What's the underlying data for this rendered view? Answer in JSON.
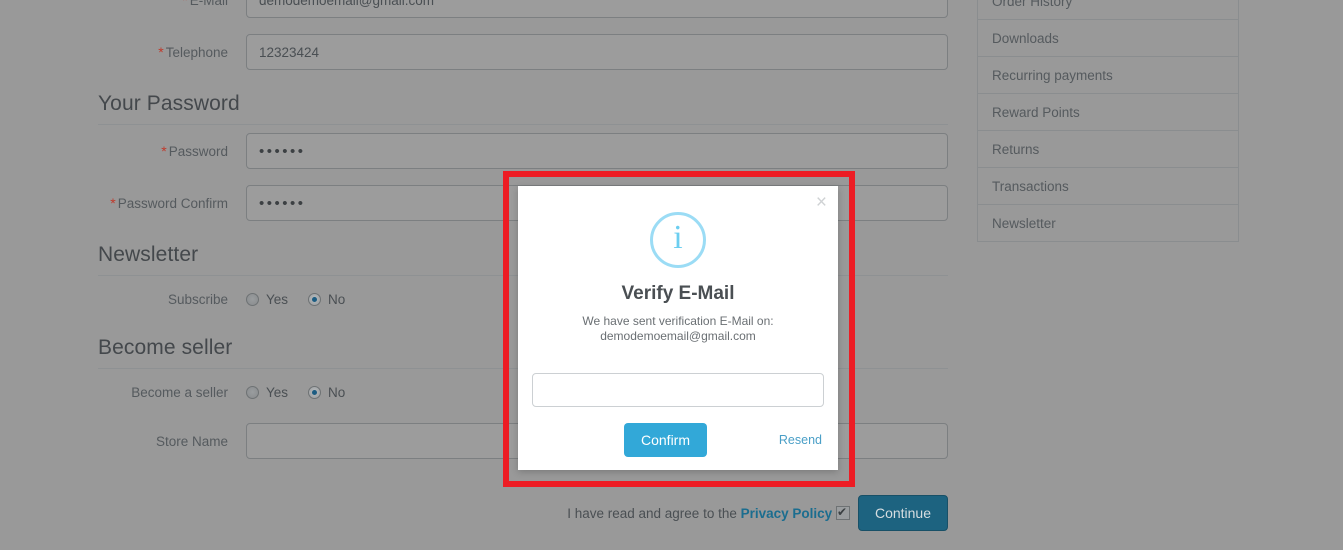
{
  "background_color": "#999999",
  "form": {
    "rows": [
      {
        "label": "E-Mail",
        "required": true,
        "value": "demodemoemail@gmail.com",
        "type": "text"
      },
      {
        "label": "Telephone",
        "required": true,
        "value": "12323424",
        "type": "text"
      }
    ],
    "password_section": {
      "heading": "Your Password",
      "rows": [
        {
          "label": "Password",
          "required": true,
          "value": "••••••",
          "type": "password"
        },
        {
          "label": "Password Confirm",
          "required": true,
          "value": "••••••",
          "type": "password"
        }
      ]
    },
    "newsletter_section": {
      "heading": "Newsletter",
      "row_label": "Subscribe",
      "options": [
        {
          "label": "Yes",
          "checked": false
        },
        {
          "label": "No",
          "checked": true
        }
      ]
    },
    "seller_section": {
      "heading": "Become seller",
      "row_label": "Become a seller",
      "options": [
        {
          "label": "Yes",
          "checked": false
        },
        {
          "label": "No",
          "checked": true
        }
      ],
      "store_name_label": "Store Name",
      "store_name_value": ""
    }
  },
  "agree": {
    "text_before": "I have read and agree to the",
    "link_text": "Privacy Policy",
    "checked": true,
    "continue_label": "Continue",
    "continue_color": "#1d6380"
  },
  "sidebar": {
    "items": [
      {
        "label": "Order History"
      },
      {
        "label": "Downloads"
      },
      {
        "label": "Recurring payments"
      },
      {
        "label": "Reward Points"
      },
      {
        "label": "Returns"
      },
      {
        "label": "Transactions"
      },
      {
        "label": "Newsletter"
      }
    ]
  },
  "highlight": {
    "color": "#ed1c24",
    "border_width": "6px"
  },
  "modal": {
    "close_glyph": "×",
    "icon": "info-icon",
    "icon_glyph": "i",
    "icon_color": "#6ccef0",
    "title": "Verify E-Mail",
    "subtitle_line1": "We have sent verification E-Mail on:",
    "subtitle_line2": "demodemoemail@gmail.com",
    "input_value": "",
    "input_placeholder": "",
    "confirm_label": "Confirm",
    "confirm_color": "#32a8d8",
    "resend_label": "Resend"
  }
}
